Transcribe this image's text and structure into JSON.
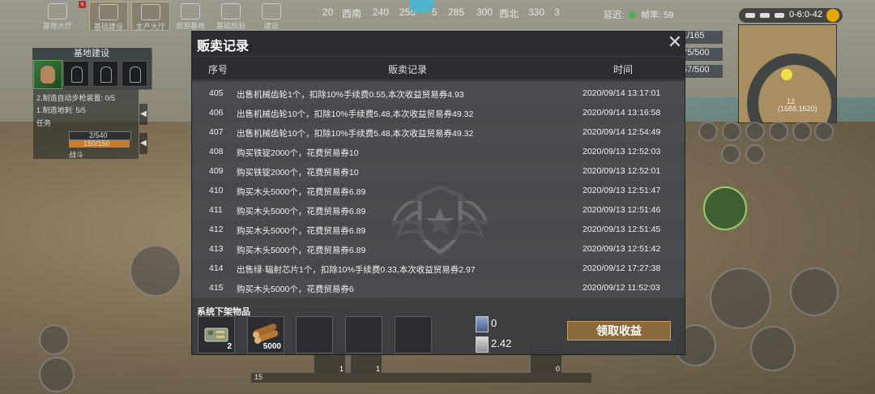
{
  "top_tabs": [
    {
      "label": "基地大厅"
    },
    {
      "label": "基础建设"
    },
    {
      "label": "生产大厅"
    },
    {
      "label": "旅游基地"
    },
    {
      "label": "基础规划"
    },
    {
      "label": "建设"
    }
  ],
  "badge": "x",
  "compass": {
    "ticks": [
      "20",
      "西南",
      "240",
      "255",
      "5",
      "285",
      "300",
      "西北",
      "330",
      "3"
    ]
  },
  "status": {
    "ping_label": "延迟:",
    "fps_label": "帧率: 59",
    "clock": "0-6:0-42"
  },
  "base": {
    "title": "基地建设",
    "quests": [
      "2.制造自动步枪装置: 0/5",
      "1.制造地刺: 5/5"
    ],
    "task_label": "任务",
    "hp": "2/540",
    "exp": "150/150",
    "tag": "战斗"
  },
  "stats": [
    "1/165",
    "75/500",
    "57/500"
  ],
  "minimap": {
    "level": "12",
    "coords": "(1688,1620)"
  },
  "hotbar": [
    "1",
    "1",
    "0"
  ],
  "bottom_bar_num": "15",
  "modal": {
    "title": "贩卖记录",
    "close_label": "✕",
    "columns": {
      "id": "序号",
      "record": "贩卖记录",
      "time": "时间"
    },
    "rows": [
      {
        "id": "405",
        "record": "出售机械齿轮1个，扣除10%手续费0.55,本次收益贸易券4.93",
        "time": "2020/09/14 13:17:01"
      },
      {
        "id": "406",
        "record": "出售机械齿轮10个，扣除10%手续费5.48,本次收益贸易券49.32",
        "time": "2020/09/14 13:16:58"
      },
      {
        "id": "407",
        "record": "出售机械齿轮10个，扣除10%手续费5.48,本次收益贸易券49.32",
        "time": "2020/09/14 12:54:49"
      },
      {
        "id": "408",
        "record": "购买铁锭2000个，花费贸易券10",
        "time": "2020/09/13 12:52:03"
      },
      {
        "id": "409",
        "record": "购买铁锭2000个，花费贸易券10",
        "time": "2020/09/13 12:52:01"
      },
      {
        "id": "410",
        "record": "购买木头5000个，花费贸易券6.89",
        "time": "2020/09/13 12:51:47"
      },
      {
        "id": "411",
        "record": "购买木头5000个，花费贸易券6.89",
        "time": "2020/09/13 12:51:46"
      },
      {
        "id": "412",
        "record": "购买木头5000个，花费贸易券6.89",
        "time": "2020/09/13 12:51:45"
      },
      {
        "id": "413",
        "record": "购买木头5000个，花费贸易券6.89",
        "time": "2020/09/13 12:51:42"
      },
      {
        "id": "414",
        "record": "出售绿·辐射芯片1个，扣除10%手续费0.33,本次收益贸易券2.97",
        "time": "2020/09/12 17:27:38"
      },
      {
        "id": "415",
        "record": "购买木头5000个，花费贸易券6",
        "time": "2020/09/12 11:52:03"
      }
    ],
    "removed_items_label": "系统下架物品",
    "items": [
      {
        "name": "circuit-board",
        "qty": "2"
      },
      {
        "name": "wood-logs",
        "qty": "5000"
      },
      {
        "name": "empty",
        "qty": ""
      },
      {
        "name": "empty",
        "qty": ""
      },
      {
        "name": "empty",
        "qty": ""
      }
    ],
    "currency_a": "0",
    "currency_b": "2.42",
    "collect_label": "领取收益"
  }
}
